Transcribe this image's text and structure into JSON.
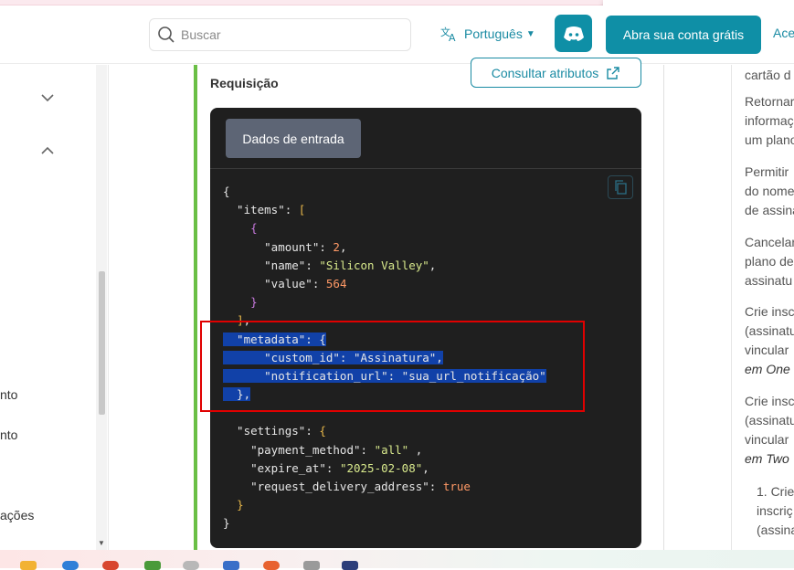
{
  "header": {
    "search_placeholder": "Buscar",
    "language_label": "Português",
    "cta_label": "Abra sua conta grátis",
    "cta2_label": "Ace"
  },
  "sidebar": {
    "items": [
      "nto",
      "nto",
      "ações"
    ]
  },
  "main": {
    "section_title": "Requisição",
    "attributes_button": "Consultar atributos",
    "tab_label": "Dados de entrada"
  },
  "code_lines": [
    [
      {
        "t": "{",
        "c": "p"
      }
    ],
    [
      {
        "t": "  \"items\"",
        "c": "k"
      },
      {
        "t": ": ",
        "c": "p"
      },
      {
        "t": "[",
        "c": "b"
      }
    ],
    [
      {
        "t": "    ",
        "c": "p"
      },
      {
        "t": "{",
        "c": "br"
      }
    ],
    [
      {
        "t": "      \"amount\"",
        "c": "k"
      },
      {
        "t": ": ",
        "c": "p"
      },
      {
        "t": "2",
        "c": "n"
      },
      {
        "t": ",",
        "c": "p"
      }
    ],
    [
      {
        "t": "      \"name\"",
        "c": "k"
      },
      {
        "t": ": ",
        "c": "p"
      },
      {
        "t": "\"Silicon Valley\"",
        "c": "s"
      },
      {
        "t": ",",
        "c": "p"
      }
    ],
    [
      {
        "t": "      \"value\"",
        "c": "k"
      },
      {
        "t": ": ",
        "c": "p"
      },
      {
        "t": "564",
        "c": "n"
      }
    ],
    [
      {
        "t": "    ",
        "c": "p"
      },
      {
        "t": "}",
        "c": "br"
      }
    ],
    [
      {
        "t": "  ",
        "c": "p"
      },
      {
        "t": "]",
        "c": "b"
      },
      {
        "t": ",",
        "c": "p"
      }
    ],
    [
      {
        "t": "  \"metadata\": {",
        "c": "k",
        "sel": true
      }
    ],
    [
      {
        "t": "      \"custom_id\": \"Assinatura\",",
        "c": "k",
        "sel": true
      }
    ],
    [
      {
        "t": "      \"notification_url\": \"sua_url_notificação\"",
        "c": "k",
        "sel": true
      }
    ],
    [
      {
        "t": "  },",
        "c": "k",
        "sel": true
      }
    ],
    [
      {
        "t": "",
        "c": "p"
      }
    ],
    [
      {
        "t": "  \"settings\"",
        "c": "k"
      },
      {
        "t": ": ",
        "c": "p"
      },
      {
        "t": "{",
        "c": "b"
      }
    ],
    [
      {
        "t": "    \"payment_method\"",
        "c": "k"
      },
      {
        "t": ": ",
        "c": "p"
      },
      {
        "t": "\"all\"",
        "c": "s"
      },
      {
        "t": " ,",
        "c": "p"
      }
    ],
    [
      {
        "t": "    \"expire_at\"",
        "c": "k"
      },
      {
        "t": ": ",
        "c": "p"
      },
      {
        "t": "\"2025-02-08\"",
        "c": "s"
      },
      {
        "t": ",",
        "c": "p"
      }
    ],
    [
      {
        "t": "    \"request_delivery_address\"",
        "c": "k"
      },
      {
        "t": ": ",
        "c": "p"
      },
      {
        "t": "true",
        "c": "n"
      }
    ],
    [
      {
        "t": "  ",
        "c": "p"
      },
      {
        "t": "}",
        "c": "b"
      }
    ],
    [
      {
        "t": "}",
        "c": "p"
      }
    ]
  ],
  "right_column": [
    {
      "text": "cartão d",
      "italic": false
    },
    {
      "text": "Retornar",
      "italic": false
    },
    {
      "text": "informaç",
      "italic": false
    },
    {
      "text": "um plano",
      "italic": false
    },
    {
      "text": "Permitir",
      "italic": false
    },
    {
      "text": "do nome",
      "italic": false
    },
    {
      "text": "de assina",
      "italic": false
    },
    {
      "text": "Cancelar",
      "italic": false
    },
    {
      "text": "plano de",
      "italic": false
    },
    {
      "text": "assinatu",
      "italic": false
    },
    {
      "text": "Crie insc",
      "italic": false
    },
    {
      "text": "(assinatu",
      "italic": false
    },
    {
      "text": "vincular",
      "italic": false
    },
    {
      "text": "em One",
      "italic": true
    },
    {
      "text": "Crie insc",
      "italic": false
    },
    {
      "text": "(assinatu",
      "italic": false
    },
    {
      "text": "vincular",
      "italic": false
    },
    {
      "text": "em Two",
      "italic": true
    },
    {
      "text": "1. Crie",
      "italic": false
    },
    {
      "text": "inscriç",
      "italic": false
    },
    {
      "text": "(assina",
      "italic": false
    }
  ]
}
